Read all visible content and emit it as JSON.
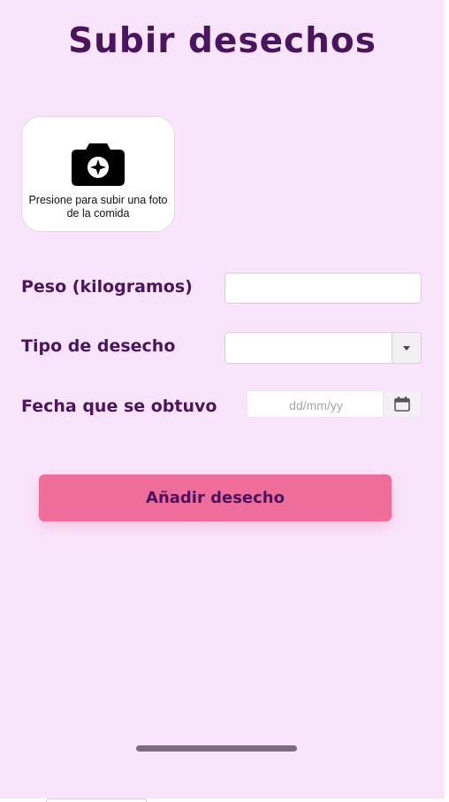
{
  "page": {
    "title": "Subir desechos"
  },
  "photo_upload": {
    "icon": "camera-icon",
    "text": "Presione para subir una foto de la comida"
  },
  "form": {
    "weight": {
      "label": "Peso (kilogramos)",
      "value": ""
    },
    "waste_type": {
      "label": "Tipo de desecho",
      "selected": ""
    },
    "date": {
      "label": "Fecha que se obtuvo",
      "placeholder": "dd/mm/yy",
      "icon": "calendar-icon"
    }
  },
  "actions": {
    "add_label": "Añadir desecho"
  },
  "colors": {
    "background": "#f9e5fb",
    "title": "#4a155e",
    "button": "#ef6e99"
  }
}
